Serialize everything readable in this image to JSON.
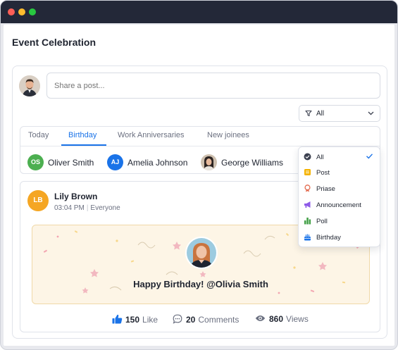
{
  "window": {
    "title": ""
  },
  "page": {
    "title": "Event Celebration"
  },
  "composer": {
    "placeholder": "Share a post..."
  },
  "filter": {
    "selected": "All"
  },
  "tabs": [
    {
      "label": "Today",
      "active": false
    },
    {
      "label": "Birthday",
      "active": true
    },
    {
      "label": "Work Anniversaries",
      "active": false
    },
    {
      "label": "New joinees",
      "active": false
    }
  ],
  "people": [
    {
      "initials": "OS",
      "name": "Oliver Smith",
      "color": "#4caf50"
    },
    {
      "initials": "AJ",
      "name": "Amelia Johnson",
      "color": "#1a73e8"
    },
    {
      "initials": "",
      "name": "George Williams",
      "color": ""
    }
  ],
  "post": {
    "author_initials": "LB",
    "author": "Lily Brown",
    "time": "03:04 PM",
    "audience": "Everyone",
    "banner_text": "Happy Birthday! @Olivia Smith"
  },
  "stats": {
    "likes": "150",
    "likes_label": "Like",
    "comments": "20",
    "comments_label": "Comments",
    "views": "860",
    "views_label": "Views"
  },
  "dropdown": {
    "items": [
      {
        "label": "All",
        "icon": "check-circle-icon",
        "checked": true
      },
      {
        "label": "Post",
        "icon": "note-icon"
      },
      {
        "label": "Priase",
        "icon": "medal-icon"
      },
      {
        "label": "Announcement",
        "icon": "megaphone-icon"
      },
      {
        "label": "Poll",
        "icon": "bar-chart-icon"
      },
      {
        "label": "Birthday",
        "icon": "cake-icon"
      }
    ]
  },
  "colors": {
    "accent": "#1a73e8",
    "titlebar": "#232838"
  }
}
